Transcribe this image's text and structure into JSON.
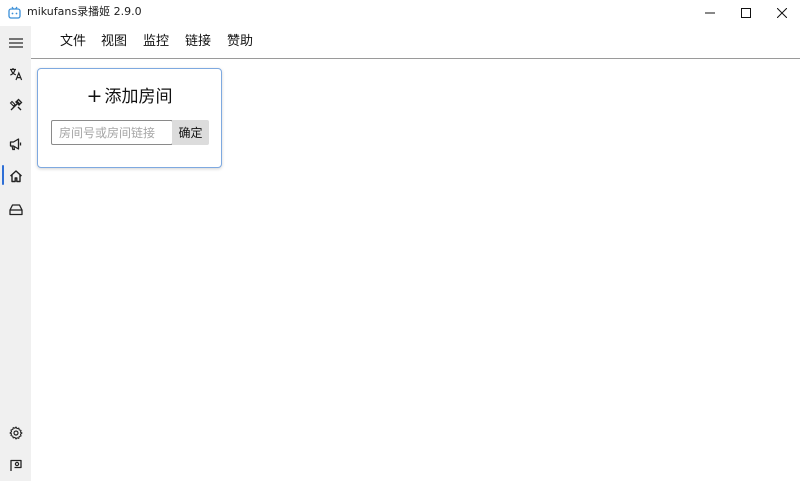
{
  "window": {
    "title": "mikufans录播姬 2.9.0",
    "icon": "tv-icon"
  },
  "menu": [
    {
      "label": "文件"
    },
    {
      "label": "视图"
    },
    {
      "label": "监控"
    },
    {
      "label": "链接"
    },
    {
      "label": "赞助"
    }
  ],
  "sidebar": {
    "items": [
      {
        "icon": "hamburger-menu-icon"
      },
      {
        "icon": "translate-icon"
      },
      {
        "icon": "tools-icon"
      },
      {
        "icon": "megaphone-icon"
      },
      {
        "icon": "home-icon",
        "active": true
      },
      {
        "icon": "storage-icon"
      }
    ],
    "bottom_items": [
      {
        "icon": "gear-icon"
      },
      {
        "icon": "feedback-icon"
      }
    ]
  },
  "add_room": {
    "title": "添加房间",
    "input_placeholder": "房间号或房间链接",
    "input_value": "",
    "confirm_label": "确定"
  },
  "colors": {
    "accent": "#2f6fd6",
    "card_border": "#7ea9e0",
    "sidebar_bg": "#f0f0f0",
    "button_bg": "#dcdcdc"
  }
}
